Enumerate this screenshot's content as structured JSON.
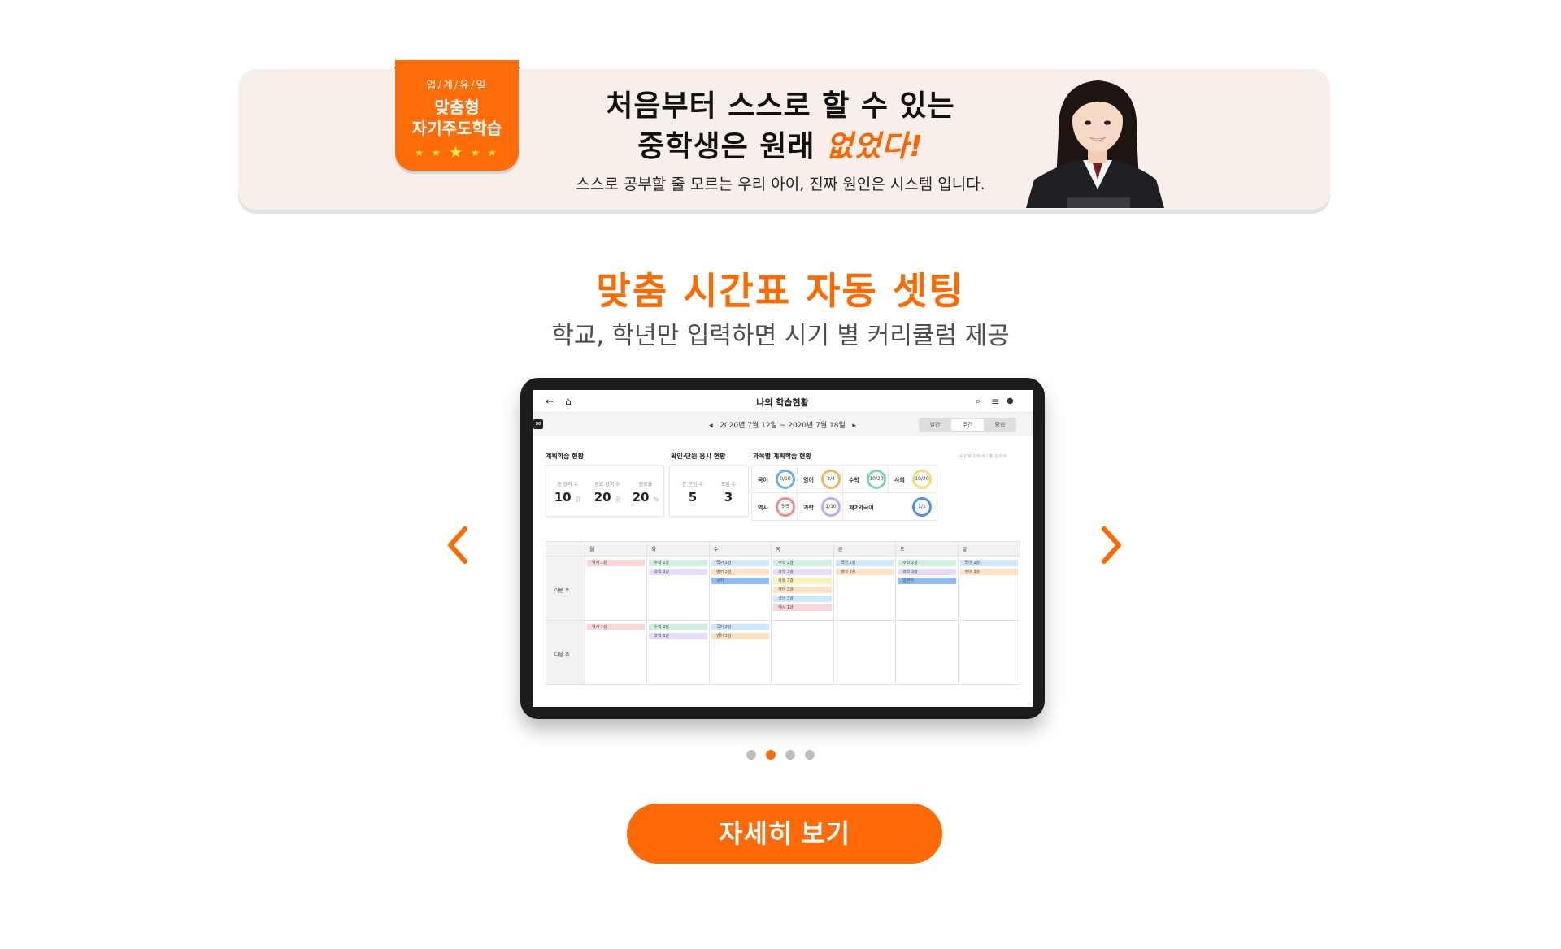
{
  "banner": {
    "badge_top": "업/계/유/일",
    "badge_line1": "맞춤형",
    "badge_line2": "자기주도학습",
    "headline_line1": "처음부터 스스로 할 수 있는",
    "headline_line2_pre": "중학생은 원래 ",
    "headline_line2_hl": "없었다!",
    "subline": "스스로 공부할 줄 모르는 우리 아이, 진짜 원인은 시스템 입니다."
  },
  "section": {
    "title": "맞춤 시간표 자동 셋팅",
    "subtitle": "학교, 학년만 입력하면 시기 별 커리큘럼 제공"
  },
  "tablet": {
    "app_title": "나의 학습현황",
    "date_range": "2020년 7월 12일 ~ 2020년 7월 18일",
    "view_tabs": [
      "일간",
      "주간",
      "종합"
    ],
    "active_tab": "주간",
    "plan_label": "계획학습 현황",
    "check_label": "확인·단원 응시 현황",
    "subject_label": "과목별 계획학습 현황",
    "legend_note": "※ 완료 강의 수 / 총 강의 수",
    "plan_stats": [
      {
        "label": "총 강의 수",
        "value": "10",
        "unit": "강"
      },
      {
        "label": "완료 강의 수",
        "value": "20",
        "unit": "강"
      },
      {
        "label": "완료율",
        "value": "20",
        "unit": "%"
      }
    ],
    "check_stats": [
      {
        "label": "푼 문항 수",
        "value": "5"
      },
      {
        "label": "오답 수",
        "value": "3"
      }
    ],
    "subjects": [
      {
        "name": "국어",
        "progress": "0/10",
        "color": "#6bb0f2"
      },
      {
        "name": "영어",
        "progress": "2/4",
        "color": "#f7b35b"
      },
      {
        "name": "수학",
        "progress": "10/20",
        "color": "#7ed4b7"
      },
      {
        "name": "사회",
        "progress": "10/20",
        "color": "#f4df6b"
      },
      {
        "name": "역사",
        "progress": "5/5",
        "color": "#f08c8c"
      },
      {
        "name": "과학",
        "progress": "1/10",
        "color": "#c7a6ee"
      },
      {
        "name": "제2외국어",
        "progress": "1/1",
        "color": "#4f8ff0"
      }
    ],
    "days": [
      "월",
      "화",
      "수",
      "목",
      "금",
      "토",
      "일"
    ],
    "rows": [
      {
        "label": "이번 주",
        "cells": [
          [
            {
              "t": "역사 1강",
              "c": "#fbd6d6"
            }
          ],
          [
            {
              "t": "수학 2강",
              "c": "#cdf0e2"
            },
            {
              "t": "과학 3강",
              "c": "#e6dcf8"
            }
          ],
          [
            {
              "t": "국어 2강",
              "c": "#cfe6fb"
            },
            {
              "t": "영어 3강",
              "c": "#fde3c4"
            },
            {
              "t": "국어",
              "c": "#8fbcf5"
            }
          ],
          [
            {
              "t": "수학 2강",
              "c": "#cdf0e2"
            },
            {
              "t": "과학 3강",
              "c": "#e6dcf8"
            },
            {
              "t": "사회 3강",
              "c": "#fbf1bd"
            },
            {
              "t": "영어 3강",
              "c": "#fde3c4"
            },
            {
              "t": "국어 3강",
              "c": "#cfe6fb"
            },
            {
              "t": "역사 1강",
              "c": "#fbd6d6"
            }
          ],
          [
            {
              "t": "국어 2강",
              "c": "#cfe6fb"
            },
            {
              "t": "영어 3강",
              "c": "#fde3c4"
            }
          ],
          [
            {
              "t": "수학 2강",
              "c": "#cdf0e2"
            },
            {
              "t": "과학 3강",
              "c": "#e6dcf8"
            },
            {
              "t": "일본어",
              "c": "#8fbcf5"
            }
          ],
          [
            {
              "t": "국어 2강",
              "c": "#cfe6fb"
            },
            {
              "t": "영어 3강",
              "c": "#fde3c4"
            }
          ]
        ]
      },
      {
        "label": "다음 주",
        "cells": [
          [
            {
              "t": "역사 1강",
              "c": "#fbd6d6"
            }
          ],
          [
            {
              "t": "수학 2강",
              "c": "#cdf0e2"
            },
            {
              "t": "과학 3강",
              "c": "#e6dcf8"
            }
          ],
          [
            {
              "t": "국어 2강",
              "c": "#cfe6fb"
            },
            {
              "t": "영어 3강",
              "c": "#fde3c4"
            }
          ],
          [],
          [],
          [],
          []
        ]
      }
    ]
  },
  "carousel": {
    "slide_count": 4,
    "active_index": 1
  },
  "cta": {
    "label": "자세히 보기"
  },
  "colors": {
    "accent": "#ff6a00",
    "banner_bg": "#f8efeb"
  }
}
